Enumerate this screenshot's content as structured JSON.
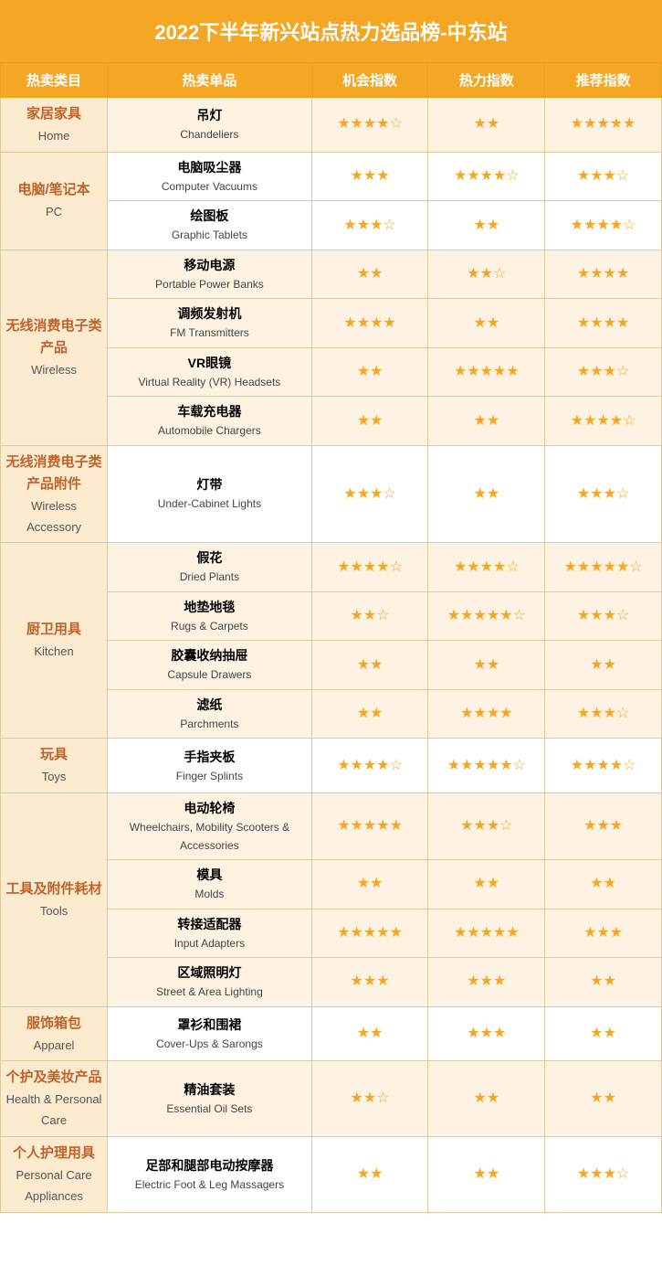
{
  "title": "2022下半年新兴站点热力选品榜-中东站",
  "headers": {
    "category": "热卖类目",
    "product": "热卖单品",
    "opportunity": "机会指数",
    "heat": "热力指数",
    "recommend": "推荐指数"
  },
  "rows": [
    {
      "cat_cn": "家居家具",
      "cat_en": "Home",
      "product_cn": "吊灯",
      "product_en": "Chandeliers",
      "opportunity": "★★★★☆",
      "heat": "★★",
      "recommend": "★★★★★",
      "rowspan": 1
    },
    {
      "cat_cn": "电脑/笔记本",
      "cat_en": "PC",
      "product_cn": "电脑吸尘器",
      "product_en": "Computer Vacuums",
      "opportunity": "★★★",
      "heat": "★★★★☆",
      "recommend": "★★★☆",
      "rowspan": 2
    },
    {
      "cat_cn": null,
      "cat_en": null,
      "product_cn": "绘图板",
      "product_en": "Graphic Tablets",
      "opportunity": "★★★☆",
      "heat": "★★",
      "recommend": "★★★★☆",
      "rowspan": 0
    },
    {
      "cat_cn": "无线消费电子类产品",
      "cat_en": "Wireless",
      "product_cn": "移动电源",
      "product_en": "Portable Power Banks",
      "opportunity": "★★",
      "heat": "★★☆",
      "recommend": "★★★★",
      "rowspan": 4
    },
    {
      "cat_cn": null,
      "cat_en": null,
      "product_cn": "调频发射机",
      "product_en": "FM Transmitters",
      "opportunity": "★★★★",
      "heat": "★★",
      "recommend": "★★★★",
      "rowspan": 0
    },
    {
      "cat_cn": null,
      "cat_en": null,
      "product_cn": "VR眼镜",
      "product_en": "Virtual Reality (VR) Headsets",
      "opportunity": "★★",
      "heat": "★★★★★",
      "recommend": "★★★☆",
      "rowspan": 0
    },
    {
      "cat_cn": null,
      "cat_en": null,
      "product_cn": "车载充电器",
      "product_en": "Automobile Chargers",
      "opportunity": "★★",
      "heat": "★★",
      "recommend": "★★★★☆",
      "rowspan": 0
    },
    {
      "cat_cn": "无线消费电子类产品附件",
      "cat_en": "Wireless Accessory",
      "product_cn": "灯带",
      "product_en": "Under-Cabinet Lights",
      "opportunity": "★★★☆",
      "heat": "★★",
      "recommend": "★★★☆",
      "rowspan": 1
    },
    {
      "cat_cn": "厨卫用具",
      "cat_en": "Kitchen",
      "product_cn": "假花",
      "product_en": "Dried Plants",
      "opportunity": "★★★★☆",
      "heat": "★★★★☆",
      "recommend": "★★★★★☆",
      "rowspan": 4
    },
    {
      "cat_cn": null,
      "cat_en": null,
      "product_cn": "地垫地毯",
      "product_en": "Rugs & Carpets",
      "opportunity": "★★☆",
      "heat": "★★★★★☆",
      "recommend": "★★★☆",
      "rowspan": 0
    },
    {
      "cat_cn": null,
      "cat_en": null,
      "product_cn": "胶囊收纳抽屉",
      "product_en": "Capsule Drawers",
      "opportunity": "★★",
      "heat": "★★",
      "recommend": "★★",
      "rowspan": 0
    },
    {
      "cat_cn": null,
      "cat_en": null,
      "product_cn": "滤纸",
      "product_en": "Parchments",
      "opportunity": "★★",
      "heat": "★★★★",
      "recommend": "★★★☆",
      "rowspan": 0
    },
    {
      "cat_cn": "玩具",
      "cat_en": "Toys",
      "product_cn": "手指夹板",
      "product_en": "Finger Splints",
      "opportunity": "★★★★☆",
      "heat": "★★★★★☆",
      "recommend": "★★★★☆",
      "rowspan": 1
    },
    {
      "cat_cn": "工具及附件耗材",
      "cat_en": "Tools",
      "product_cn": "电动轮椅",
      "product_en": "Wheelchairs, Mobility Scooters & Accessories",
      "opportunity": "★★★★★",
      "heat": "★★★☆",
      "recommend": "★★★",
      "rowspan": 4
    },
    {
      "cat_cn": null,
      "cat_en": null,
      "product_cn": "模具",
      "product_en": "Molds",
      "opportunity": "★★",
      "heat": "★★",
      "recommend": "★★",
      "rowspan": 0
    },
    {
      "cat_cn": null,
      "cat_en": null,
      "product_cn": "转接适配器",
      "product_en": "Input Adapters",
      "opportunity": "★★★★★",
      "heat": "★★★★★",
      "recommend": "★★★",
      "rowspan": 0
    },
    {
      "cat_cn": null,
      "cat_en": null,
      "product_cn": "区域照明灯",
      "product_en": "Street & Area Lighting",
      "opportunity": "★★★",
      "heat": "★★★",
      "recommend": "★★",
      "rowspan": 0
    },
    {
      "cat_cn": "服饰箱包",
      "cat_en": "Apparel",
      "product_cn": "罩衫和围裙",
      "product_en": "Cover-Ups & Sarongs",
      "opportunity": "★★",
      "heat": "★★★",
      "recommend": "★★",
      "rowspan": 1
    },
    {
      "cat_cn": "个护及美妆产品",
      "cat_en": "Health & Personal Care",
      "product_cn": "精油套装",
      "product_en": "Essential Oil Sets",
      "opportunity": "★★☆",
      "heat": "★★",
      "recommend": "★★",
      "rowspan": 1
    },
    {
      "cat_cn": "个人护理用具",
      "cat_en": "Personal Care Appliances",
      "product_cn": "足部和腿部电动按摩器",
      "product_en": "Electric Foot & Leg Massagers",
      "opportunity": "★★",
      "heat": "★★",
      "recommend": "★★★☆",
      "rowspan": 1
    }
  ]
}
